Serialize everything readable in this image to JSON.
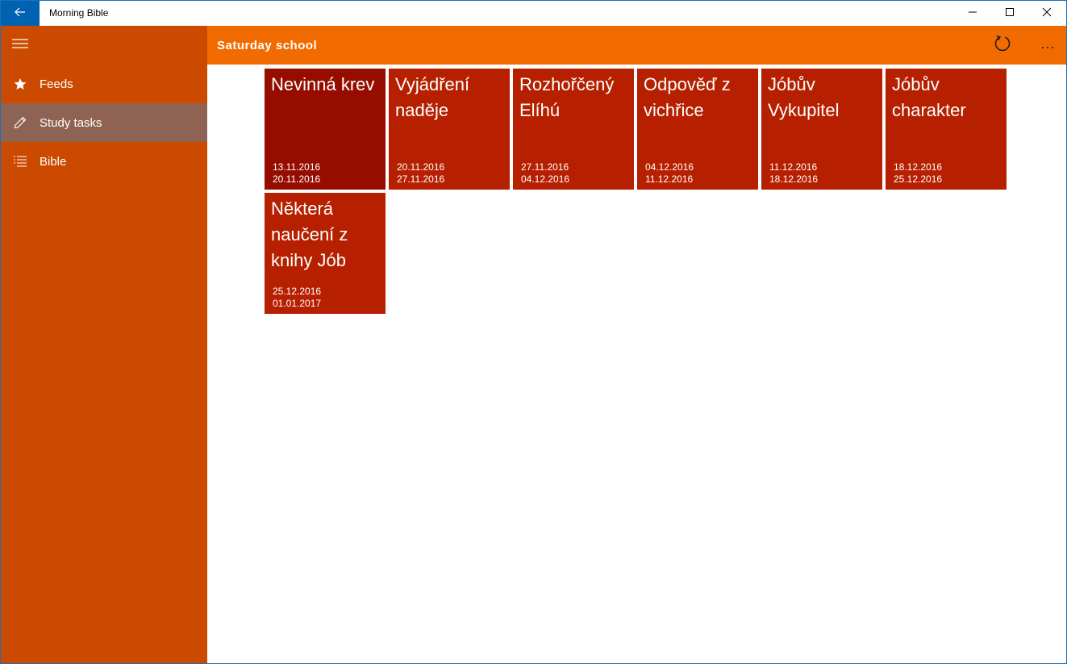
{
  "app": {
    "title": "Morning Bible",
    "accent": "#f26b00",
    "sidebar_color": "#cc4a00",
    "titlebar_back_color": "#0063b1"
  },
  "sidebar": {
    "items": [
      {
        "label": "Feeds",
        "icon": "star-icon"
      },
      {
        "label": "Study tasks",
        "icon": "pencil-icon"
      },
      {
        "label": "Bible",
        "icon": "list-icon"
      }
    ],
    "selected": "Study tasks"
  },
  "header": {
    "title": "Saturday school"
  },
  "tiles": [
    {
      "title": "Nevinná krev",
      "start": "13.11.2016",
      "end": "20.11.2016"
    },
    {
      "title": "Vyjádření naděje",
      "start": "20.11.2016",
      "end": "27.11.2016"
    },
    {
      "title": "Rozhořčený Elíhú",
      "start": "27.11.2016",
      "end": "04.12.2016"
    },
    {
      "title": "Odpověď z vichřice",
      "start": "04.12.2016",
      "end": "11.12.2016"
    },
    {
      "title": "Jóbův Vykupitel",
      "start": "11.12.2016",
      "end": "18.12.2016"
    },
    {
      "title": "Jóbův charakter",
      "start": "18.12.2016",
      "end": "25.12.2016"
    },
    {
      "title": "Některá naučení z knihy Jób",
      "start": "25.12.2016",
      "end": "01.01.2017"
    }
  ]
}
